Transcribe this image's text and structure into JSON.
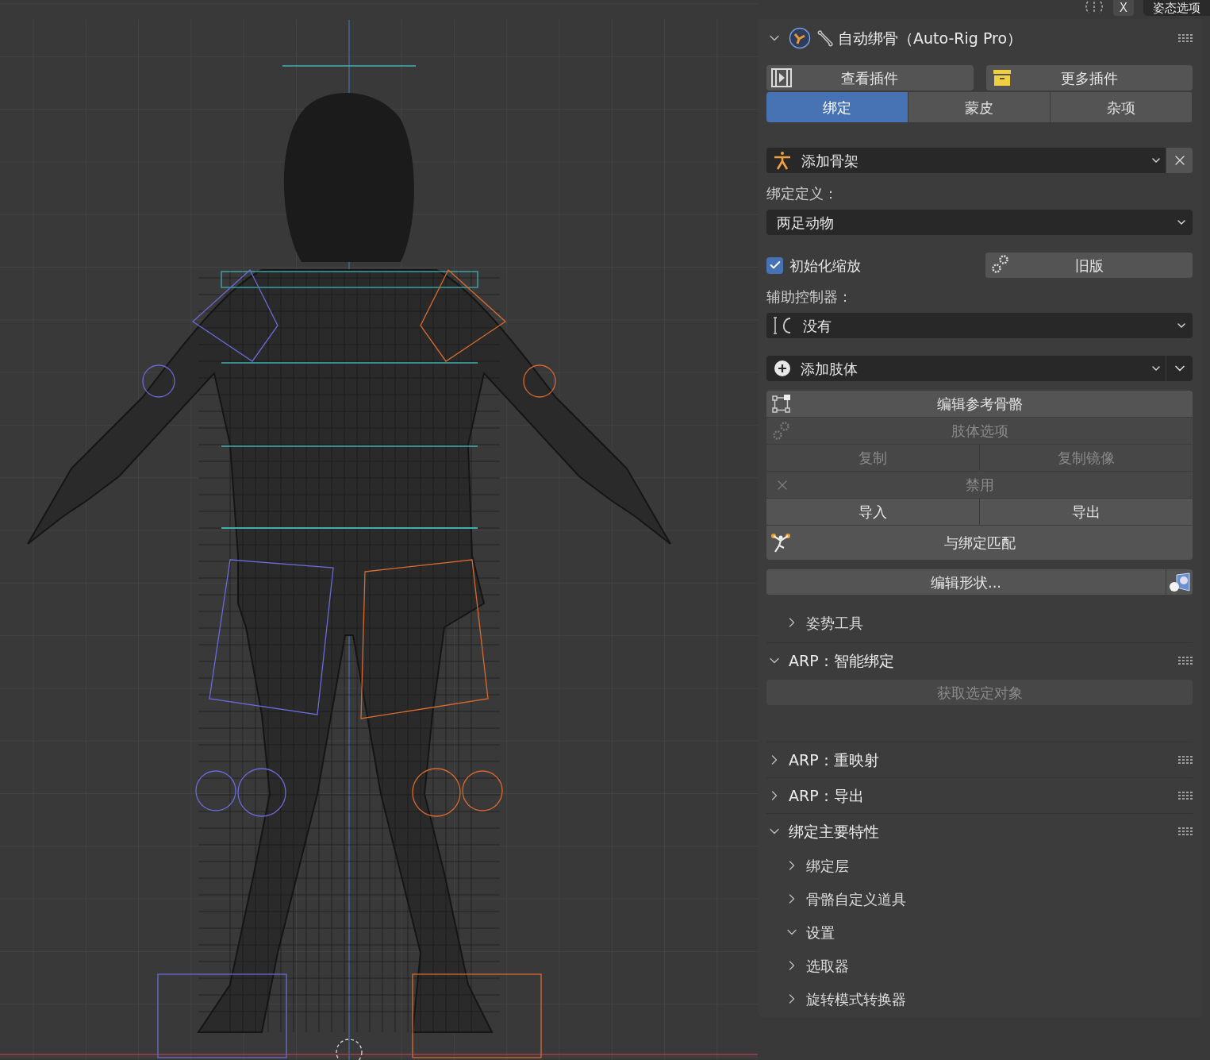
{
  "header": {
    "close_label": "X",
    "tab": {
      "label": "姿态选项",
      "selected": true
    }
  },
  "panel": {
    "title": "自动绑骨（Auto-Rig Pro）",
    "expanded": true,
    "link_buttons": [
      {
        "kind": "film",
        "label": "查看插件"
      },
      {
        "kind": "archive",
        "label": "更多插件"
      }
    ],
    "tabs": [
      {
        "label": "绑定",
        "selected": true
      },
      {
        "label": "蒙皮",
        "selected": false
      },
      {
        "label": "杂项",
        "selected": false
      }
    ],
    "add_armature": {
      "label": "添加骨架"
    },
    "rig_definition": {
      "label": "绑定定义：",
      "value": "两足动物"
    },
    "init_scale": {
      "label": "初始化缩放",
      "checked": true
    },
    "legacy_button": {
      "label": "旧版"
    },
    "helper": {
      "label": "辅助控制器：",
      "value": "没有"
    },
    "add_limb": {
      "label": "添加肢体"
    },
    "action_rows": [
      {
        "kind": "bones",
        "buttons": [
          {
            "label": "编辑参考骨骼",
            "disabled": false
          }
        ]
      },
      {
        "kind": "gears",
        "buttons": [
          {
            "label": "肢体选项",
            "disabled": true
          }
        ]
      },
      {
        "kind": "none",
        "buttons": [
          {
            "label": "复制",
            "disabled": true
          },
          {
            "label": "复制镜像",
            "disabled": true
          }
        ]
      },
      {
        "kind": "cross",
        "buttons": [
          {
            "label": "禁用",
            "disabled": true
          }
        ]
      },
      {
        "kind": "none",
        "buttons": [
          {
            "label": "导入",
            "disabled": false
          },
          {
            "label": "导出",
            "disabled": false
          }
        ]
      },
      {
        "kind": "figure",
        "buttons": [
          {
            "label": "与绑定匹配",
            "disabled": false
          }
        ]
      }
    ],
    "edit_shape": {
      "label": "编辑形状..."
    },
    "subpanels": [
      {
        "title": "姿势工具",
        "expanded": false
      }
    ]
  },
  "panels": [
    {
      "title": "ARP：智能绑定",
      "expanded": true,
      "button": {
        "label": "获取选定对象",
        "disabled": true
      }
    },
    {
      "title": "ARP：重映射",
      "expanded": false
    },
    {
      "title": "ARP：导出",
      "expanded": false
    },
    {
      "title": "绑定主要特性",
      "expanded": true,
      "subpanels": [
        {
          "title": "绑定层",
          "expanded": false
        },
        {
          "title": "骨骼自定义道具",
          "expanded": false
        },
        {
          "title": "设置",
          "expanded": true
        },
        {
          "title": "选取器",
          "expanded": false
        },
        {
          "title": "旋转模式转换器",
          "expanded": false
        }
      ]
    }
  ]
}
